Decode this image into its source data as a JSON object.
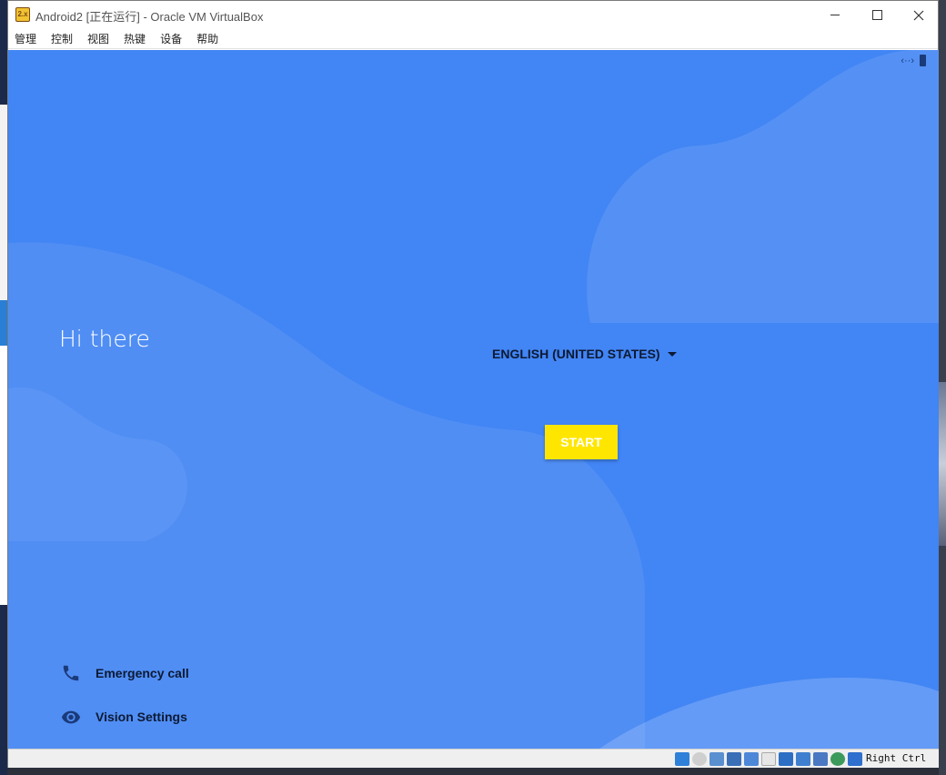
{
  "window": {
    "title": "Android2 [正在运行] - Oracle VM VirtualBox",
    "app_icon_text": "2.x"
  },
  "menu": [
    "管理",
    "控制",
    "视图",
    "热键",
    "设备",
    "帮助"
  ],
  "android": {
    "status_icons": [
      "network-icon",
      "battery-icon"
    ],
    "greeting": "Hi there",
    "language": "ENGLISH (UNITED STATES)",
    "start_label": "START",
    "emergency_label": "Emergency call",
    "vision_label": "Vision Settings",
    "colors": {
      "background": "#4285f4",
      "start_button": "#ffe600",
      "text_dark": "#0d1a33"
    }
  },
  "statusbar": {
    "icons": [
      "hard-disk-icon",
      "optical-drive-icon",
      "audio-icon",
      "network-icon",
      "usb-icon",
      "shared-folder-icon",
      "display-icon",
      "recording-icon",
      "virtualization-icon",
      "mouse-integration-icon",
      "keyboard-icon"
    ],
    "host_key": "Right Ctrl"
  }
}
